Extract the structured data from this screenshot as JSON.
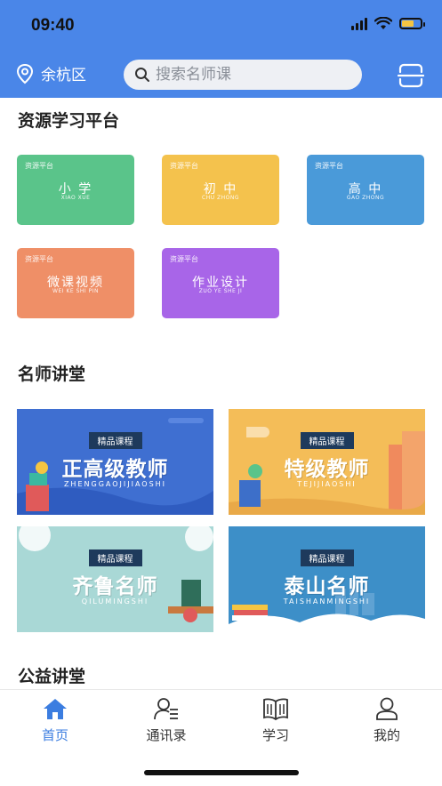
{
  "status_bar": {
    "time": "09:40"
  },
  "header": {
    "location": "余杭区",
    "search_placeholder": "搜索名师课"
  },
  "resources": {
    "title": "资源学习平台",
    "cards": [
      {
        "tag": "资源平台",
        "title": "小 学",
        "pinyin": "XIAO XUE",
        "color": "#5ac48a"
      },
      {
        "tag": "资源平台",
        "title": "初 中",
        "pinyin": "CHU ZHONG",
        "color": "#f4c24d"
      },
      {
        "tag": "资源平台",
        "title": "高 中",
        "pinyin": "GAO ZHONG",
        "color": "#4a9ad9"
      },
      {
        "tag": "资源平台",
        "title": "微课视频",
        "pinyin": "WEI KE SHI PIN",
        "color": "#ef8f67"
      },
      {
        "tag": "资源平台",
        "title": "作业设计",
        "pinyin": "ZUO YE SHE JI",
        "color": "#a865e8"
      }
    ]
  },
  "famous": {
    "title": "名师讲堂",
    "banners": [
      {
        "badge": "精品课程",
        "title": "正高级教师",
        "pinyin": "ZHENGGAOJIJIAOSHI",
        "color": "#3f6fd1"
      },
      {
        "badge": "精品课程",
        "title": "特级教师",
        "pinyin": "TEJIJIAOSHI",
        "color": "#f4bd58"
      },
      {
        "badge": "精品课程",
        "title": "齐鲁名师",
        "pinyin": "QILUMINGSHI",
        "color": "#a9d8d6"
      },
      {
        "badge": "精品课程",
        "title": "泰山名师",
        "pinyin": "TAISHANMINGSHI",
        "color": "#3d8fc8"
      }
    ]
  },
  "public": {
    "title": "公益讲堂"
  },
  "tabbar": {
    "active_color": "#3b7de0",
    "items": [
      {
        "label": "首页",
        "icon": "home-icon"
      },
      {
        "label": "通讯录",
        "icon": "contacts-icon"
      },
      {
        "label": "学习",
        "icon": "book-icon"
      },
      {
        "label": "我的",
        "icon": "user-icon"
      }
    ]
  }
}
